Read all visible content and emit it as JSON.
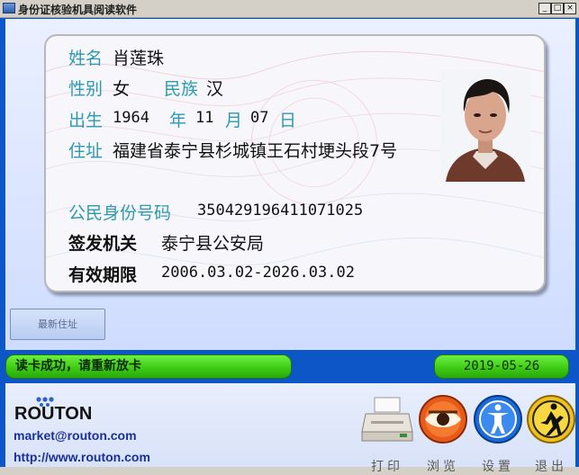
{
  "window": {
    "title": "身份证核验机具阅读软件"
  },
  "card": {
    "name_label": "姓名",
    "name": "肖莲珠",
    "gender_label": "性别",
    "gender": "女",
    "ethnicity_label": "民族",
    "ethnicity": "汉",
    "birth_label": "出生",
    "birth_year": "1964",
    "year_label": "年",
    "birth_month": "11",
    "month_label": "月",
    "birth_day": "07",
    "day_label": "日",
    "address_label": "住址",
    "address": "福建省泰宁县杉城镇王石村埂头段7号",
    "id_label": "公民身份号码",
    "id_number": "350429196411071025",
    "authority_label": "签发机关",
    "authority": "泰宁县公安局",
    "validity_label": "有效期限",
    "validity": "2006.03.02-2026.03.02"
  },
  "buttons": {
    "latest_address": "最新住址"
  },
  "status": {
    "message": "读卡成功，请重新放卡",
    "date": "2019-05-26"
  },
  "brand": {
    "logo": "ROUTON",
    "email": "market@routon.com",
    "website": "http://www.routon.com"
  },
  "toolbar": {
    "print": "打印",
    "browse": "浏览",
    "settings": "设置",
    "exit": "退出"
  },
  "colors": {
    "frame": "#0c56c8",
    "label": "#2b9ab0",
    "status_green": "#3cc812"
  }
}
